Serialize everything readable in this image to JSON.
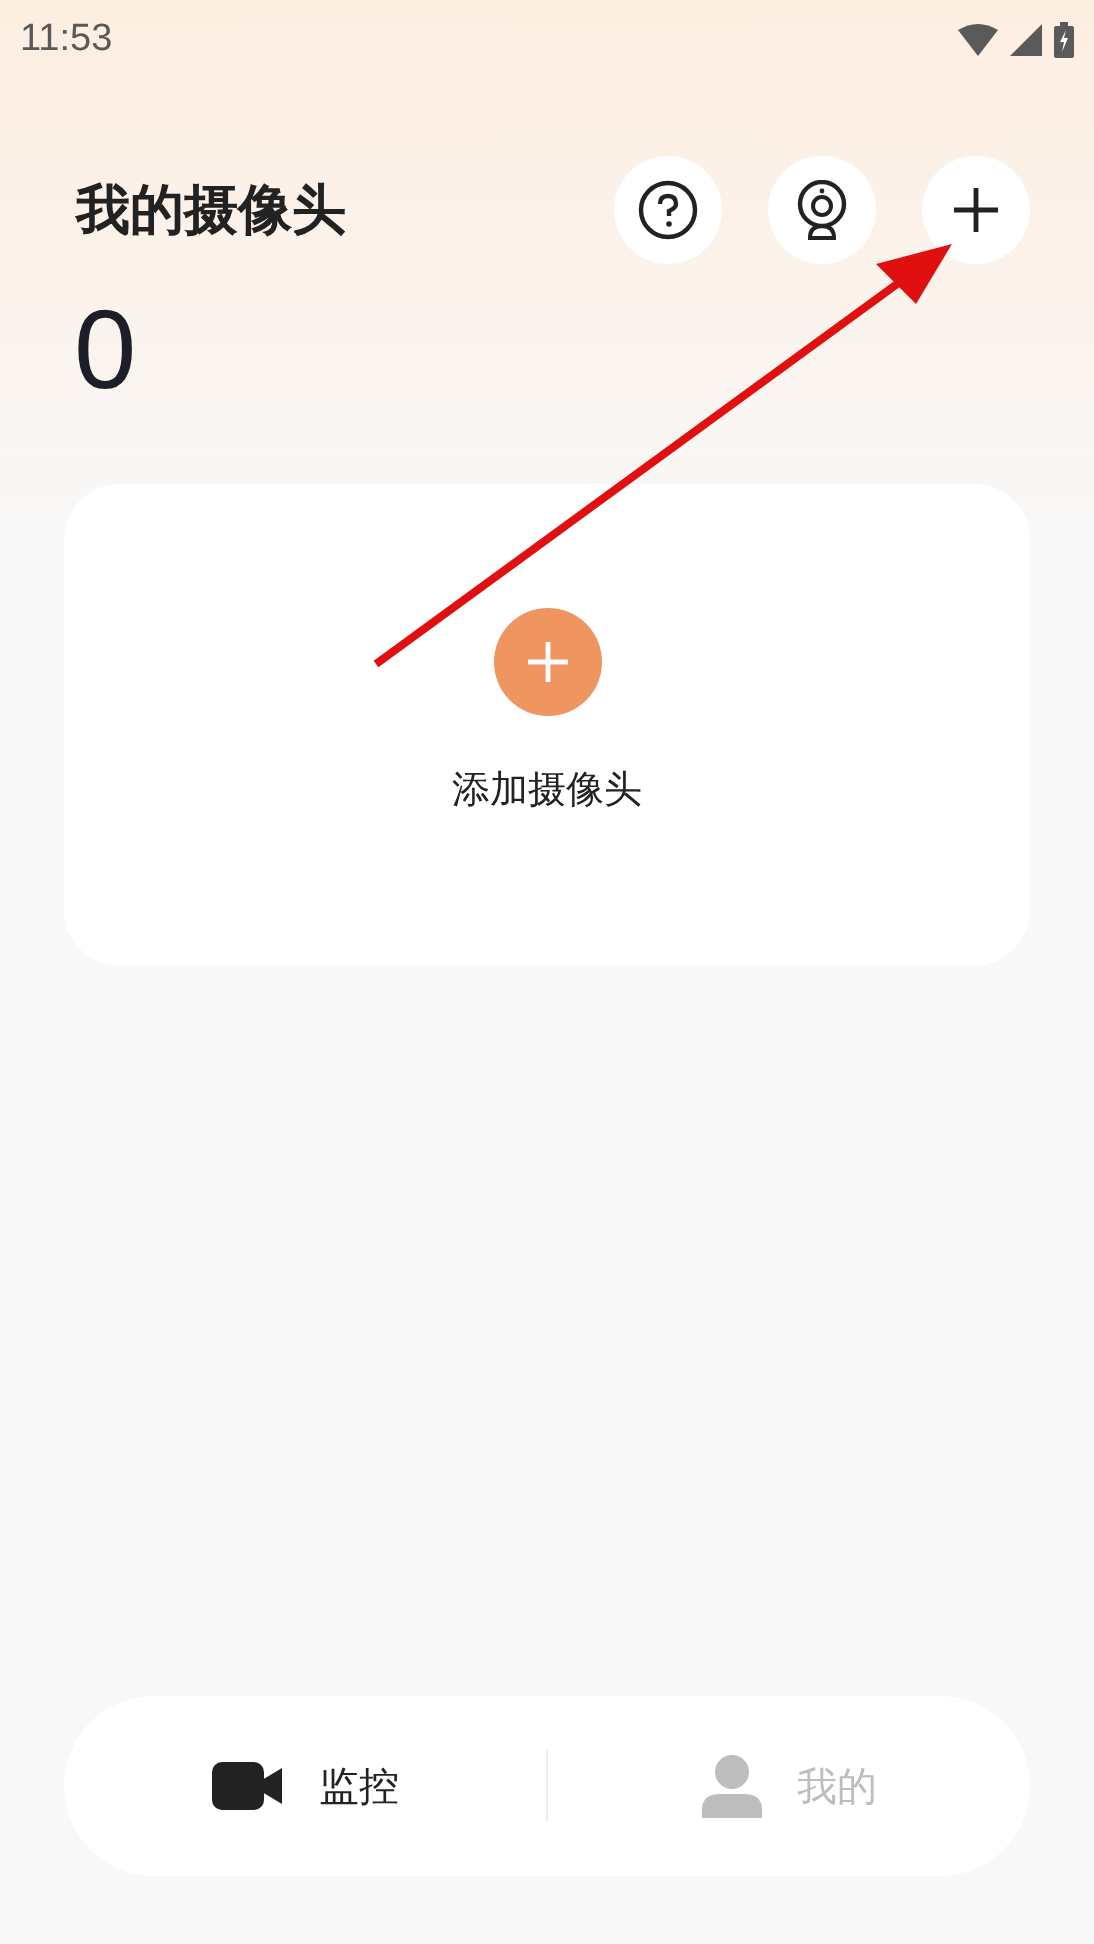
{
  "status_bar": {
    "time": "11:53"
  },
  "header": {
    "title": "我的摄像头",
    "count": "0"
  },
  "empty_card": {
    "label": "添加摄像头"
  },
  "bottom_nav": [
    {
      "label": "监控",
      "kind": "camera",
      "selected": true
    },
    {
      "label": "我的",
      "kind": "profile",
      "selected": false
    }
  ]
}
